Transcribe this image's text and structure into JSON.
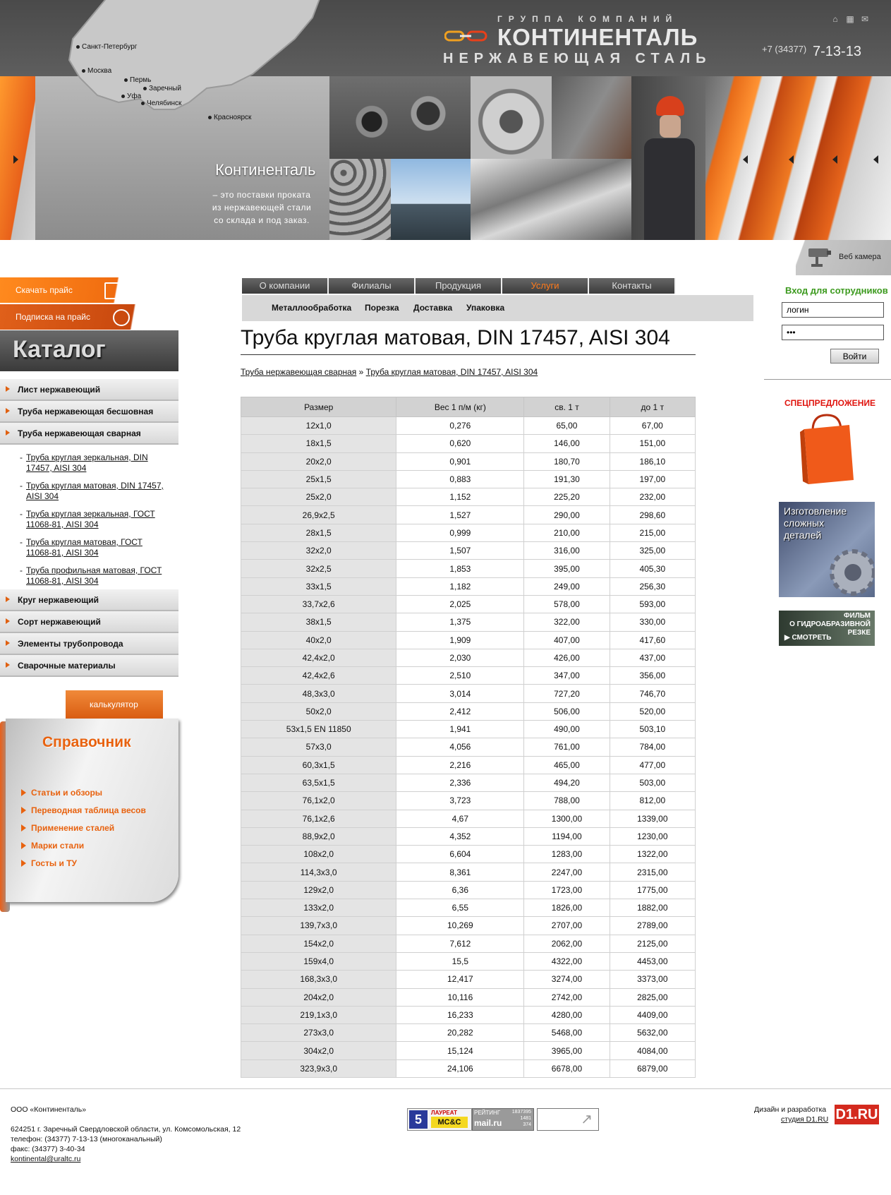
{
  "header": {
    "logo_group": "ГРУППА КОМПАНИЙ",
    "logo_name": "КОНТИНЕНТАЛЬ",
    "logo_sub": "НЕРЖАВЕЮЩАЯ СТАЛЬ",
    "phone_prefix": "+7 (34377)",
    "phone_number": "7-13-13",
    "icons": [
      "home-icon",
      "sitemap-icon",
      "mail-icon"
    ]
  },
  "hero": {
    "cities": [
      "Санкт-Петербург",
      "Москва",
      "Пермь",
      "Заречный",
      "Уфа",
      "Челябинск",
      "Красноярск"
    ],
    "title": "Континенталь",
    "text": [
      "– это поставки проката",
      "из нержавеющей стали",
      "со склада и под заказ."
    ]
  },
  "webcam": {
    "label": "Веб камера"
  },
  "left": {
    "download_price": "Скачать прайс",
    "subscribe_price": "Подписка на прайс",
    "catalog_title": "Каталог",
    "catalog_items": [
      "Лист нержавеющий",
      "Труба нержавеющая бесшовная",
      "Труба нержавеющая сварная"
    ],
    "sub_items": [
      "Труба круглая зеркальная, DIN 17457, AISI 304",
      "Труба круглая матовая, DIN 17457, AISI 304",
      "Труба круглая зеркальная, ГОСТ 11068-81, AISI 304",
      "Труба круглая матовая, ГОСТ 11068-81, AISI 304",
      "Труба профильная матовая, ГОСТ 11068-81, AISI 304"
    ],
    "catalog_items_after": [
      "Круг нержавеющий",
      "Сорт нержавеющий",
      "Элементы трубопровода",
      "Сварочные материалы"
    ],
    "calculator": "калькулятор",
    "reference_title": "Справочник",
    "reference_items": [
      "Статьи и обзоры",
      "Переводная таблица весов",
      "Применение сталей",
      "Марки стали",
      "Госты и ТУ"
    ]
  },
  "nav": {
    "tabs": [
      "О компании",
      "Филиалы",
      "Продукция",
      "Услуги",
      "Контакты"
    ],
    "active_tab": "Услуги",
    "active_color": "#ff7a1a",
    "subnav": [
      "Металлообработка",
      "Порезка",
      "Доставка",
      "Упаковка"
    ]
  },
  "content": {
    "title": "Труба круглая матовая, DIN 17457, AISI 304",
    "breadcrumb": [
      "Труба нержавеющая сварная",
      "»",
      "Труба круглая матовая, DIN 17457, AISI 304"
    ],
    "table": {
      "headers": [
        "Размер",
        "Вес 1 п/м (кг)",
        "св. 1 т",
        "до 1 т"
      ],
      "rows": [
        [
          "12x1,0",
          "0,276",
          "65,00",
          "67,00"
        ],
        [
          "18x1,5",
          "0,620",
          "146,00",
          "151,00"
        ],
        [
          "20x2,0",
          "0,901",
          "180,70",
          "186,10"
        ],
        [
          "25x1,5",
          "0,883",
          "191,30",
          "197,00"
        ],
        [
          "25x2,0",
          "1,152",
          "225,20",
          "232,00"
        ],
        [
          "26,9x2,5",
          "1,527",
          "290,00",
          "298,60"
        ],
        [
          "28x1,5",
          "0,999",
          "210,00",
          "215,00"
        ],
        [
          "32x2,0",
          "1,507",
          "316,00",
          "325,00"
        ],
        [
          "32x2,5",
          "1,853",
          "395,00",
          "405,30"
        ],
        [
          "33x1,5",
          "1,182",
          "249,00",
          "256,30"
        ],
        [
          "33,7x2,6",
          "2,025",
          "578,00",
          "593,00"
        ],
        [
          "38x1,5",
          "1,375",
          "322,00",
          "330,00"
        ],
        [
          "40x2,0",
          "1,909",
          "407,00",
          "417,60"
        ],
        [
          "42,4x2,0",
          "2,030",
          "426,00",
          "437,00"
        ],
        [
          "42,4x2,6",
          "2,510",
          "347,00",
          "356,00"
        ],
        [
          "48,3x3,0",
          "3,014",
          "727,20",
          "746,70"
        ],
        [
          "50x2,0",
          "2,412",
          "506,00",
          "520,00"
        ],
        [
          "53x1,5 EN 11850",
          "1,941",
          "490,00",
          "503,10"
        ],
        [
          "57x3,0",
          "4,056",
          "761,00",
          "784,00"
        ],
        [
          "60,3x1,5",
          "2,216",
          "465,00",
          "477,00"
        ],
        [
          "63,5x1,5",
          "2,336",
          "494,20",
          "503,00"
        ],
        [
          "76,1x2,0",
          "3,723",
          "788,00",
          "812,00"
        ],
        [
          "76,1x2,6",
          "4,67",
          "1300,00",
          "1339,00"
        ],
        [
          "88,9x2,0",
          "4,352",
          "1194,00",
          "1230,00"
        ],
        [
          "108x2,0",
          "6,604",
          "1283,00",
          "1322,00"
        ],
        [
          "114,3x3,0",
          "8,361",
          "2247,00",
          "2315,00"
        ],
        [
          "129x2,0",
          "6,36",
          "1723,00",
          "1775,00"
        ],
        [
          "133x2,0",
          "6,55",
          "1826,00",
          "1882,00"
        ],
        [
          "139,7x3,0",
          "10,269",
          "2707,00",
          "2789,00"
        ],
        [
          "154x2,0",
          "7,612",
          "2062,00",
          "2125,00"
        ],
        [
          "159x4,0",
          "15,5",
          "4322,00",
          "4453,00"
        ],
        [
          "168,3x3,0",
          "12,417",
          "3274,00",
          "3373,00"
        ],
        [
          "204x2,0",
          "10,116",
          "2742,00",
          "2825,00"
        ],
        [
          "219,1x3,0",
          "16,233",
          "4280,00",
          "4409,00"
        ],
        [
          "273x3,0",
          "20,282",
          "5468,00",
          "5632,00"
        ],
        [
          "304x2,0",
          "15,124",
          "3965,00",
          "4084,00"
        ],
        [
          "323,9x3,0",
          "24,106",
          "6678,00",
          "6879,00"
        ]
      ]
    }
  },
  "right": {
    "login_title": "Вход для сотрудников",
    "login_value": "логин",
    "password_value": "•••",
    "login_button": "Войти",
    "special_title": "СПЕЦПРЕДЛОЖЕНИЕ",
    "banner_parts": [
      "Изготовление",
      "сложных",
      "деталей"
    ],
    "banner_film_lines": [
      "ФИЛЬМ",
      "О ГИДРОАБРАЗИВНОЙ",
      "РЕЗКЕ"
    ],
    "banner_film_button": "СМОТРЕТЬ"
  },
  "footer": {
    "company": "ООО «Континенталь»",
    "address": "624251 г. Заречный Свердловской области, ул. Комсомольская, 12",
    "phone": "телефон: (34377) 7-13-13 (многоканальный)",
    "fax": "факс: (34377) 3-40-34",
    "email": "kontinental@uraltc.ru",
    "dev_label": "Дизайн и разработка",
    "dev_link": "студия D1.RU",
    "dev_logo": "D1.RU",
    "counter_rating": "РЕЙТИНГ",
    "counter_brand": "mail.ru",
    "counter_numbers": [
      "1837395",
      "1481",
      "374"
    ],
    "laureate": "ЛАУРЕАТ",
    "laureate_brand": "МС&С"
  }
}
